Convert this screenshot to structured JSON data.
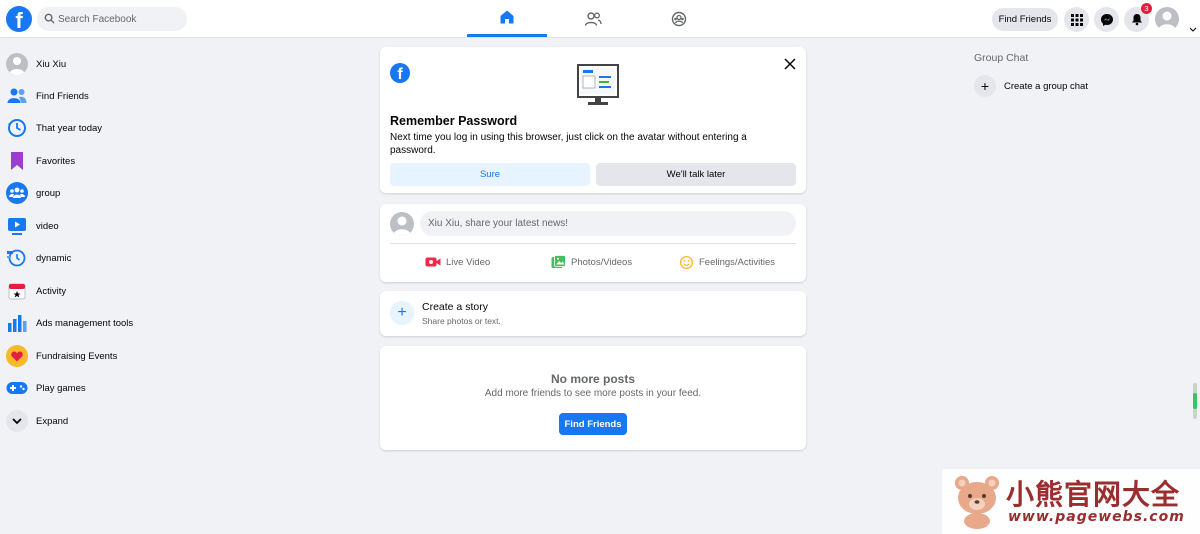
{
  "header": {
    "search_placeholder": "Search Facebook",
    "find_friends_label": "Find Friends",
    "notification_count": "3",
    "nav_tabs": [
      {
        "name": "home",
        "active": true
      },
      {
        "name": "friends",
        "active": false
      },
      {
        "name": "groups",
        "active": false
      }
    ]
  },
  "sidebar": {
    "items": [
      {
        "label": "Xiu Xiu",
        "icon": "avatar"
      },
      {
        "label": "Find Friends",
        "icon": "friends-icon"
      },
      {
        "label": "That year today",
        "icon": "clock-icon"
      },
      {
        "label": "Favorites",
        "icon": "bookmark-icon"
      },
      {
        "label": "group",
        "icon": "group-icon"
      },
      {
        "label": "video",
        "icon": "video-icon"
      },
      {
        "label": "dynamic",
        "icon": "dynamic-icon"
      },
      {
        "label": "Activity",
        "icon": "calendar-icon"
      },
      {
        "label": "Ads management tools",
        "icon": "bar-chart-icon"
      },
      {
        "label": "Fundraising Events",
        "icon": "heart-icon"
      },
      {
        "label": "Play games",
        "icon": "gamepad-icon"
      },
      {
        "label": "Expand",
        "icon": "chevron-down-icon"
      }
    ]
  },
  "remember": {
    "title": "Remember Password",
    "text": "Next time you log in using this browser, just click on the avatar without entering a password.",
    "sure_label": "Sure",
    "later_label": "We'll talk later"
  },
  "composer": {
    "placeholder": "Xiu Xiu, share your latest news!",
    "live_label": "Live Video",
    "photo_label": "Photos/Videos",
    "feeling_label": "Feelings/Activities"
  },
  "story": {
    "title": "Create a story",
    "subtitle": "Share photos or text."
  },
  "feed_end": {
    "title": "No more posts",
    "subtitle": "Add more friends to see more posts in your feed.",
    "button_label": "Find Friends"
  },
  "group_chat": {
    "title": "Group Chat",
    "create_label": "Create a group chat"
  },
  "watermark": {
    "brand_cn": "小熊官网大全",
    "url": "www.pagewebs.com"
  },
  "colors": {
    "brand": "#1877f2",
    "background": "#f0f2f5",
    "badge": "#e41e3f"
  }
}
